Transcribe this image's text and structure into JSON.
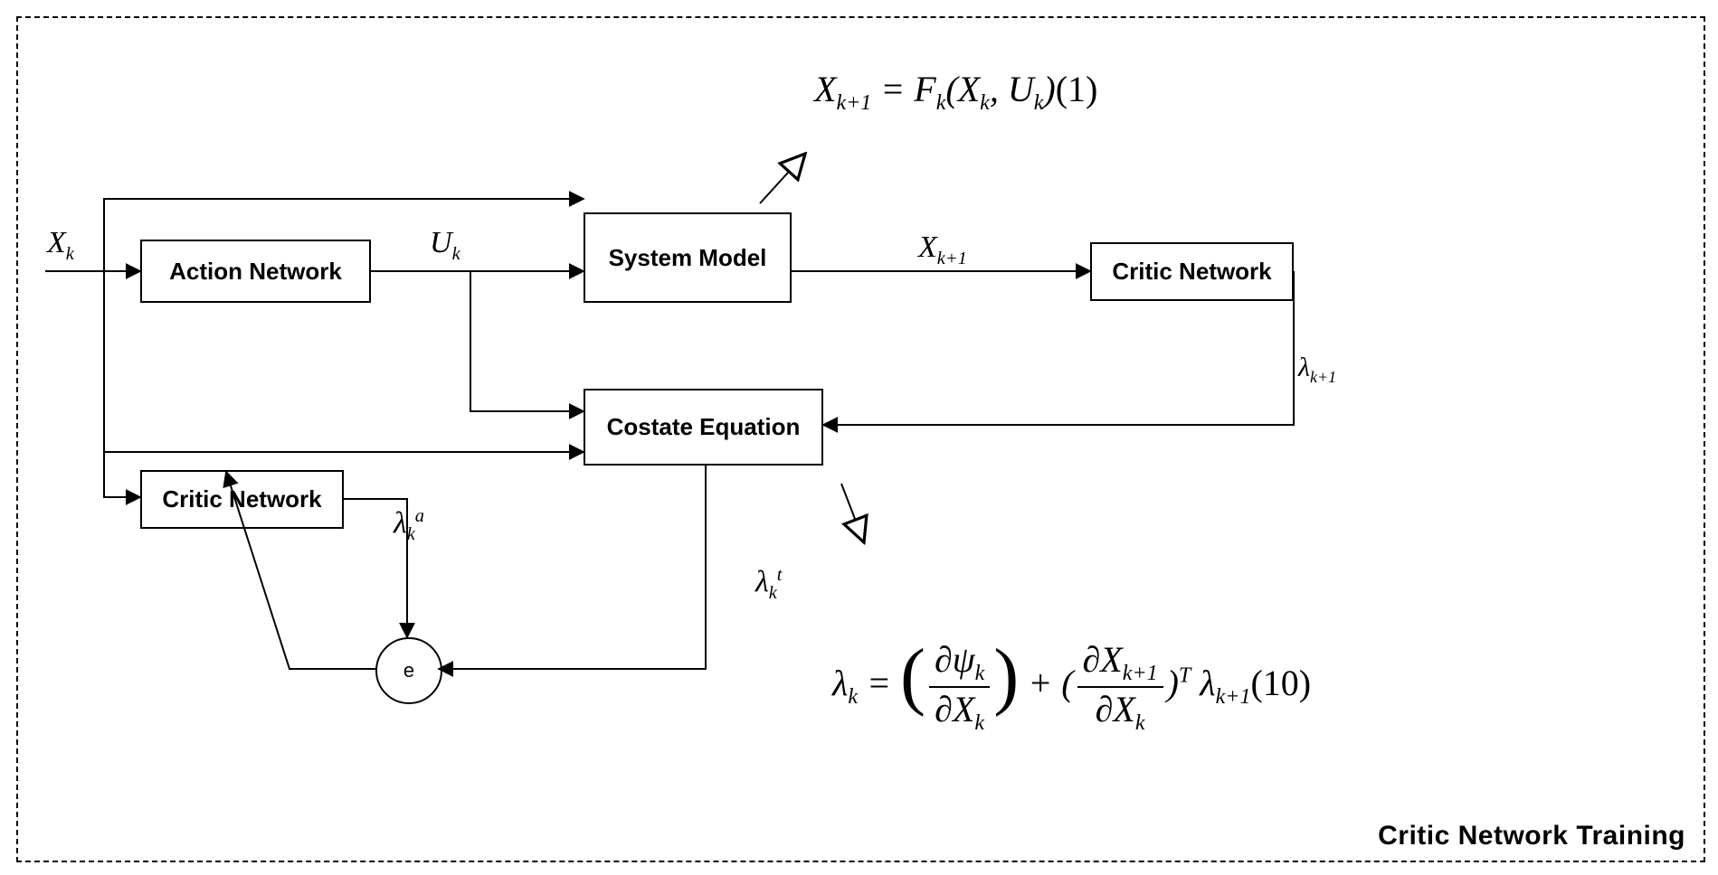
{
  "title": "Critic Network Training",
  "blocks": {
    "action": "Action Network",
    "system": "System Model",
    "critic_right": "Critic Network",
    "costate": "Costate Equation",
    "critic_left": "Critic Network"
  },
  "signals": {
    "x_k": "X<sub>k</sub>",
    "u_k": "U<sub>k</sub>",
    "x_k1": "X<sub>k+1</sub>",
    "lambda_k1": "λ<sub>k+1</sub>",
    "lambda_ka": "λ<sub>k</sub><sup>a</sup>",
    "lambda_kt": "λ<sub>k</sub><sup>t</sup>",
    "error": "e"
  },
  "equations": {
    "system_eq": "X<sub>k+1</sub> = F<sub>k</sub>(X<sub>k</sub>, U<sub>k</sub>)<span class='up'>(1)</span>",
    "costate_eq": "λ<sub>k</sub> = <span class='paren-l'>(</span><span class='frac'><span class='num'>∂ψ<sub>k</sub></span><span class='den'>∂X<sub>k</sub></span></span><span class='paren-r'>)</span> + (<span class='frac'><span class='num'>∂X<sub>k+1</sub></span><span class='den'>∂X<sub>k</sub></span></span>)<sup>T</sup> λ<sub>k+1</sub><span class='up'>(10)</span>"
  }
}
